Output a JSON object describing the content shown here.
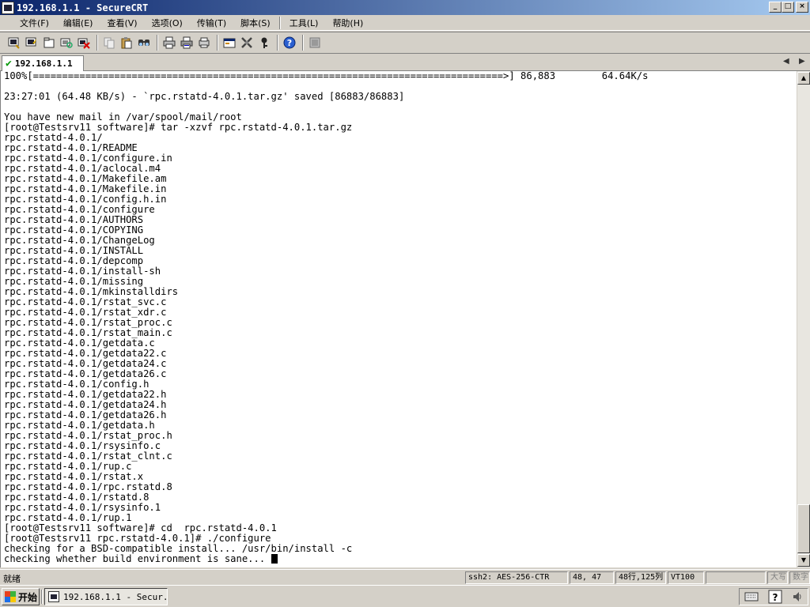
{
  "window": {
    "title": "192.168.1.1 - SecureCRT",
    "controls": {
      "minimize": "_",
      "maximize": "□",
      "close": "×"
    }
  },
  "menu": {
    "items": [
      "文件(F)",
      "编辑(E)",
      "查看(V)",
      "选项(O)",
      "传输(T)",
      "脚本(S)",
      "工具(L)",
      "帮助(H)"
    ]
  },
  "toolbar": {
    "buttons": [
      "connect-icon",
      "quick-connect-icon",
      "connect-tab-icon",
      "reconnect-icon",
      "disconnect-icon",
      "copy-icon",
      "paste-icon",
      "find-icon",
      "print-icon",
      "print-selection-icon",
      "printer-setup-icon",
      "session-options-icon",
      "global-options-icon",
      "keymap-icon",
      "help-icon",
      "lock-icon"
    ]
  },
  "tabs": [
    {
      "label": "192.168.1.1",
      "connected": true
    }
  ],
  "terminal": {
    "lines": [
      "100%[=================================================================================>] 86,883        64.64K/s",
      "",
      "23:27:01 (64.48 KB/s) - `rpc.rstatd-4.0.1.tar.gz' saved [86883/86883]",
      "",
      "You have new mail in /var/spool/mail/root",
      "[root@Testsrv11 software]# tar -xzvf rpc.rstatd-4.0.1.tar.gz",
      "rpc.rstatd-4.0.1/",
      "rpc.rstatd-4.0.1/README",
      "rpc.rstatd-4.0.1/configure.in",
      "rpc.rstatd-4.0.1/aclocal.m4",
      "rpc.rstatd-4.0.1/Makefile.am",
      "rpc.rstatd-4.0.1/Makefile.in",
      "rpc.rstatd-4.0.1/config.h.in",
      "rpc.rstatd-4.0.1/configure",
      "rpc.rstatd-4.0.1/AUTHORS",
      "rpc.rstatd-4.0.1/COPYING",
      "rpc.rstatd-4.0.1/ChangeLog",
      "rpc.rstatd-4.0.1/INSTALL",
      "rpc.rstatd-4.0.1/depcomp",
      "rpc.rstatd-4.0.1/install-sh",
      "rpc.rstatd-4.0.1/missing",
      "rpc.rstatd-4.0.1/mkinstalldirs",
      "rpc.rstatd-4.0.1/rstat_svc.c",
      "rpc.rstatd-4.0.1/rstat_xdr.c",
      "rpc.rstatd-4.0.1/rstat_proc.c",
      "rpc.rstatd-4.0.1/rstat_main.c",
      "rpc.rstatd-4.0.1/getdata.c",
      "rpc.rstatd-4.0.1/getdata22.c",
      "rpc.rstatd-4.0.1/getdata24.c",
      "rpc.rstatd-4.0.1/getdata26.c",
      "rpc.rstatd-4.0.1/config.h",
      "rpc.rstatd-4.0.1/getdata22.h",
      "rpc.rstatd-4.0.1/getdata24.h",
      "rpc.rstatd-4.0.1/getdata26.h",
      "rpc.rstatd-4.0.1/getdata.h",
      "rpc.rstatd-4.0.1/rstat_proc.h",
      "rpc.rstatd-4.0.1/rsysinfo.c",
      "rpc.rstatd-4.0.1/rstat_clnt.c",
      "rpc.rstatd-4.0.1/rup.c",
      "rpc.rstatd-4.0.1/rstat.x",
      "rpc.rstatd-4.0.1/rpc.rstatd.8",
      "rpc.rstatd-4.0.1/rstatd.8",
      "rpc.rstatd-4.0.1/rsysinfo.1",
      "rpc.rstatd-4.0.1/rup.1",
      "[root@Testsrv11 software]# cd  rpc.rstatd-4.0.1",
      "[root@Testsrv11 rpc.rstatd-4.0.1]# ./configure",
      "checking for a BSD-compatible install... /usr/bin/install -c",
      "checking whether build environment is sane... "
    ]
  },
  "status": {
    "ready": "就绪",
    "cipher": "ssh2: AES-256-CTR",
    "position": "48,  47",
    "size": "48行,125列",
    "emulation": "VT100",
    "blank": "",
    "caps": "大写",
    "num": "数字"
  },
  "taskbar": {
    "start": "开始",
    "task": "192.168.1.1 - Secur..."
  }
}
